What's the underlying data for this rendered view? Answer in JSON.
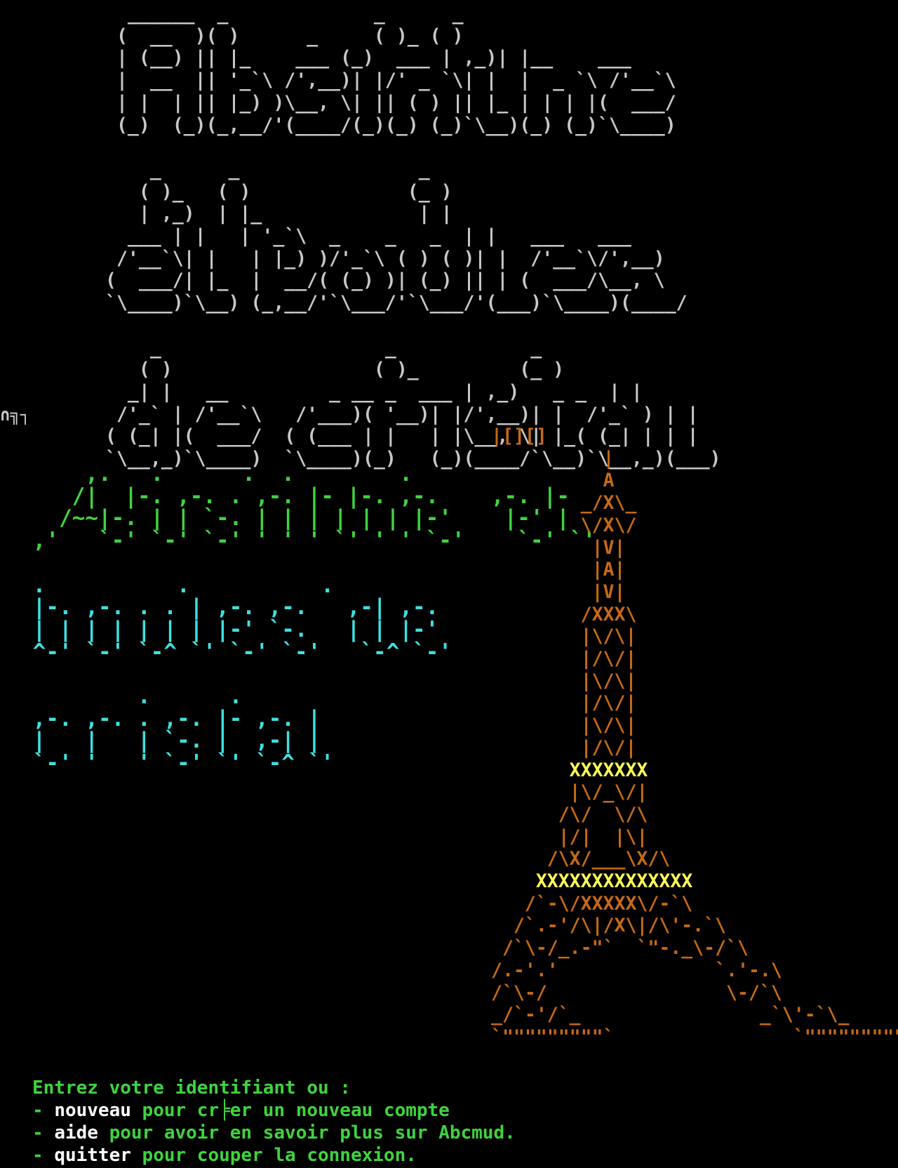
{
  "screen": {
    "title_banner_lines": [
      "  ______  _             _      _",
      " (  __  )( )      _     ( )_ ( )",
      " | (__) || |_    ___ (_)  ___ | ,_)| |__    ___",
      " |  __  || '_`\\ /',__)| |/' _ `\\| |  |  _ `\\ /'__`\\",
      " | |  | || |_) )\\__, \\| || ( ) || |_ | | | |(  ___/",
      " (_)  (_)(_,__/'(____/(_)(_) (_)`\\__)(_) (_)`\\____)",
      "",
      "    _      _                _",
      "   ( )_   ( )              (_ )",
      "   | ,_)  | |_              | |",
      "  ___ | |   | '_`\\  _    _   _  | |   ___   ___",
      " /'__`\\| |   | |_) )/'_`\\ ( ) ( )| |  /'__`\\/',__)",
      "(  ___/| |_  |  __/( (_) )| (_) || | (  ___/\\__, \\",
      "`\\____)`\\__) (_,__/'`\\___/'`\\___/'(___)`\\____)(____/",
      "",
      "    _                    _            _",
      "   ( )                  ( )_         (_ )",
      "  _| |   __         _ __ _  ___ | ,_)   _ _  | |",
      " /'_` | /'__`\\   /'___)( '__)| |/',__)| |  /'_` ) | |",
      "( (_| |(  ___/  ( (___ | |   | |\\__, \\| |_( (_| | | |",
      "`\\__,_)`\\____)  `\\____)(_)   (_)(____/`\\__)`\\__,_)(___)"
    ],
    "corner_glyph": "∩╗┐",
    "figlet_lines": {
      "absinthe_et": [
        "     ,.   .      .  .        .",
        "    /|  |-. ,-. . ,-. |- |-. ,-.    ,-. |-",
        "   /~~|-. | | `-. | | | | | | |-'    |-' |",
        " ,'   `-' `-' `-' ' ' ' `' ' ' `-'    `-' `'"
      ],
      "boules_de": [
        "",
        " .          .          .",
        " |-. ,-. . . | ,-. ,-.   ,-| ,-.",
        " | | | | | | | |-' `-.   | | |-'",
        " ^-' `-' `-^ `' `-' `-'   `-^ `-'"
      ],
      "cristal": [
        "",
        "         .      .",
        " ,-. ,-. . ,-. |- ,-. |",
        " |   |   | `-. |  ,-| |",
        " `-' '   ' `-' `' `-^ `'"
      ]
    },
    "tower": {
      "antenna": "|[][]",
      "lines": [
        "          |",
        "          A",
        "        _/X\\_",
        "        \\/X\\/",
        "         |V|",
        "         |A|",
        "         |V|",
        "        /XXX\\",
        "        |\\/\\|",
        "        |/\\/|",
        "        |\\/\\|",
        "        |/\\/|",
        "        |\\/\\|",
        "        |/\\/|"
      ],
      "band1": "       XXXXXXX",
      "lines2": [
        "       |\\/_\\/|",
        "      /\\/  \\/\\",
        "      |/|  |\\|",
        "     /\\X/___\\X/\\"
      ],
      "band2": "    XXXXXXXXXXXXXX",
      "lines3": [
        "   /`-\\/XXXXX\\/-`\\",
        "  /`.-'/\\|/X\\|/\\'-.`\\",
        " /`\\-/_.-\"`  `\"-._\\-/`\\",
        "/.-'.'              `.'-.\\",
        "/`\\-/                \\-/`\\",
        "_/`-'/`_                _`\\'-`\\_",
        "`\"\"\"\"\"\"\"\"\"`                `\"\"\"\"\"\"\"\"\"`"
      ]
    },
    "prompt": {
      "heading": "Entrez votre identifiant ou :",
      "items": [
        {
          "dash": "- ",
          "command": "nouveau",
          "desc": " pour cr╞er un nouveau compte"
        },
        {
          "dash": "- ",
          "command": "aide",
          "desc": " pour avoir en savoir plus sur Abcmud."
        },
        {
          "dash": "- ",
          "command": "quitter",
          "desc": " pour couper la connexion."
        }
      ]
    },
    "colors": {
      "background": "#000000",
      "banner": "#c8c8c8",
      "green": "#3ed43e",
      "cyan": "#3ee0e0",
      "tower": "#c86a14",
      "tower_highlight": "#ffff55",
      "command": "#ffffff"
    }
  }
}
